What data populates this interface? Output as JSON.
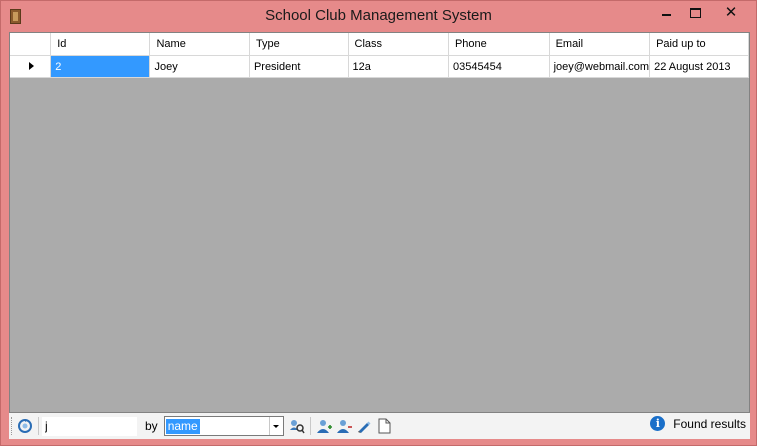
{
  "window": {
    "title": "School Club Management System",
    "close_glyph": "✕"
  },
  "grid": {
    "columns": [
      "Id",
      "Name",
      "Type",
      "Class",
      "Phone",
      "Email",
      "Paid up to"
    ],
    "rows": [
      [
        "2",
        "Joey",
        "President",
        "12a",
        "03545454",
        "joey@webmail.com",
        "22 August 2013"
      ]
    ],
    "selected_cell": "Id"
  },
  "toolbar": {
    "search_value": "j",
    "by_label": "by",
    "search_field": "name",
    "icons": [
      "refresh-icon",
      "search-users-icon",
      "add-user-icon",
      "remove-user-icon",
      "edit-icon",
      "new-document-icon"
    ]
  },
  "status": {
    "icon_glyph": "i",
    "text": "Found results"
  },
  "colors": {
    "window_frame": "#e68a8a",
    "grid_background": "#ababab",
    "selection": "#3399ff",
    "info": "#1a6fc9"
  }
}
